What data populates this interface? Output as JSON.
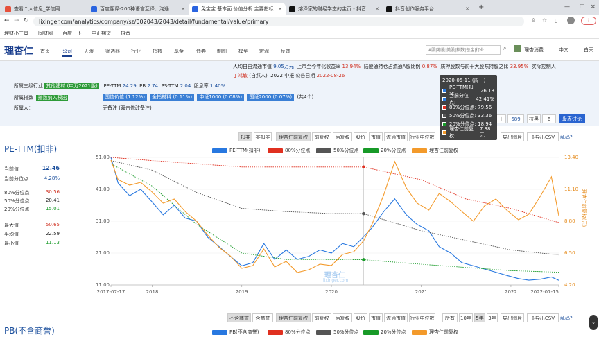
{
  "tabs": [
    {
      "title": "查看个人信息_学信网",
      "color": "#e6503b"
    },
    {
      "title": "百度翻译-200种语言互译、沟通",
      "color": "#2a64e0"
    },
    {
      "title": "免宝宝 基本面 价值分析 主要指标",
      "color": "#2a64e0"
    },
    {
      "title": "熔泽家的财经学堂的主页 - 抖音",
      "color": "#111111"
    },
    {
      "title": "抖音创作服务平台",
      "color": "#111111"
    }
  ],
  "address": {
    "url": "lixinger.com/analytics/company/sz/002043/2043/detail/fundamental/value/primary"
  },
  "bookmarks": [
    "理财小工具",
    "同财网",
    "百度一下",
    "中正期货",
    "抖音"
  ],
  "site": {
    "logo": "理杏仁",
    "nav": [
      "首页",
      "公司",
      "天眼",
      "筛选器",
      "行业",
      "指数",
      "基金",
      "债券",
      "制图",
      "模型",
      "宏观",
      "反馈"
    ],
    "search_placeholder": "A股|港股|美股|指数|基金|行业",
    "user": "理杏消费",
    "lang": "中文",
    "theme": "白天"
  },
  "info": {
    "row1_a": "人均自由流通市值",
    "row1_a_val": "9.05万元",
    "row1_b": "上市至今年化收益率",
    "row1_b_val": "13.94%",
    "row1_c": "陆股通持仓占流通A股比例",
    "row1_c_val": "0.87%",
    "row1_d": "质押股数与前十大股东持股之比",
    "row1_d_val": "33.95%",
    "row1_e": "实际控制人",
    "row2_a": "丁鸿敏",
    "row2_b": "(自然人)",
    "row2_c": "2022 中报 公告日期",
    "row2_d": "2022-08-26",
    "industry_label": "所属三级行业",
    "industry_tag": "其他建材 (申万2021版)",
    "pe_label": "PE-TTM",
    "pe_val": "24.29",
    "pb_label": "PB",
    "pb_val": "2.74",
    "ps_label": "PS-TTM",
    "ps_val": "2.04",
    "div_label": "股息率",
    "div_val": "1.40%",
    "index_label": "所属指数",
    "index_tag": "指数纳入预出",
    "indices": [
      "国信价值 (1.12%)",
      "全指材料 (0.11%)",
      "中证1000 (0.08%)",
      "国证2000 (0.07%)"
    ],
    "indices_count": "(共4个)",
    "remark_label": "所属人：",
    "remark_val": "无备注 (双击修改备注)"
  },
  "controls": {
    "right_count": "689",
    "right_btn": "拉黑",
    "right_num": "6",
    "discuss": "发表讨论"
  },
  "toolbar1": {
    "deduct": [
      "扣非",
      "非扣非"
    ],
    "adjust": [
      "理杏仁前复权",
      "前复权",
      "后复权",
      "股价",
      "市值",
      "流通市值",
      "行业中位数"
    ],
    "export_img": "导出图片",
    "export_csv": "导出CSV",
    "garbled": "乱码?"
  },
  "toolbar2": {
    "goodwill": [
      "不含商誉",
      "含商誉"
    ],
    "adjust": [
      "理杏仁前复权",
      "前复权",
      "后复权",
      "股价",
      "市值",
      "流通市值",
      "行业中位数"
    ],
    "periods": [
      "所有",
      "10年",
      "5年",
      "3年"
    ],
    "export_img": "导出图片",
    "export_csv": "导出CSV",
    "garbled": "乱码?"
  },
  "stats": {
    "title": "PE-TTM(扣非)",
    "current_label": "当前值",
    "current_val": "12.46",
    "pct_label": "当前分位点",
    "pct_val": "4.28%",
    "p80_label": "80%分位点",
    "p80_val": "30.56",
    "p50_label": "50%分位点",
    "p50_val": "20.41",
    "p20_label": "20%分位点",
    "p20_val": "15.01",
    "max_label": "最大值",
    "max_val": "50.65",
    "avg_label": "平均值",
    "avg_val": "22.59",
    "min_label": "最小值",
    "min_val": "11.13"
  },
  "tooltip": {
    "date": "2020-05-11 (周一)",
    "rows": [
      {
        "label": "PE-TTM(扣非):",
        "value": "26.13",
        "color": "#2878e0"
      },
      {
        "label": "当前分位点:",
        "value": "42.41%",
        "color": "#2878e0"
      },
      {
        "label": "80%分位点:",
        "value": "79.56",
        "color": "#e03020"
      },
      {
        "label": "50%分位点:",
        "value": "33.36",
        "color": "#555555"
      },
      {
        "label": "20%分位点:",
        "value": "18.94",
        "color": "#189a28"
      },
      {
        "label": "理杏仁前复权:",
        "value": "7.38元",
        "color": "#f39a2b"
      }
    ]
  },
  "legend1": [
    "PE-TTM(扣非)",
    "80%分位点",
    "50%分位点",
    "20%分位点",
    "理杏仁前复权"
  ],
  "legend2": [
    "PB(不含商誉)",
    "80%分位点",
    "50%分位点",
    "20%分位点",
    "理杏仁前复权"
  ],
  "section2_title": "PB(不含商誉)",
  "watermark": {
    "name": "理杏仁",
    "site": "lixinger.com"
  },
  "chart_data": {
    "type": "line",
    "x_ticks": [
      "2017-07-17",
      "2018",
      "2019",
      "2020",
      "2021",
      "2022",
      "2022-07-15"
    ],
    "y_left_ticks": [
      "51.00",
      "41.00",
      "31.00",
      "21.00",
      "11.00"
    ],
    "y_left_range": [
      11,
      51
    ],
    "y_right_ticks": [
      "13.40",
      "11.10",
      "8.80",
      "6.50",
      "4.20"
    ],
    "y_right_range": [
      4.2,
      13.4
    ],
    "y_right_label": "理杏仁前复权(元)",
    "x_range": [
      "2017-07-17",
      "2022-07-15"
    ],
    "series": [
      {
        "name": "PE-TTM(扣非)",
        "axis": "left",
        "color": "#2878e0",
        "x": [
          "2017-07-17",
          "2017-08-15",
          "2017-10-01",
          "2017-11-15",
          "2018-01-01",
          "2018-02-15",
          "2018-04-01",
          "2018-05-15",
          "2018-07-01",
          "2018-08-15",
          "2018-10-01",
          "2018-11-15",
          "2019-01-01",
          "2019-02-15",
          "2019-04-01",
          "2019-05-15",
          "2019-07-01",
          "2019-08-15",
          "2019-10-01",
          "2019-11-15",
          "2020-01-01",
          "2020-02-15",
          "2020-04-01",
          "2020-05-11",
          "2020-06-15",
          "2020-08-01",
          "2020-09-15",
          "2020-11-01",
          "2020-12-15",
          "2021-02-01",
          "2021-03-15",
          "2021-05-01",
          "2021-06-15",
          "2021-08-01",
          "2021-09-15",
          "2021-11-01",
          "2021-12-15",
          "2022-02-01",
          "2022-03-15",
          "2022-05-01",
          "2022-06-15",
          "2022-07-15"
        ],
        "y": [
          51,
          43,
          39,
          41,
          37,
          33,
          36,
          32,
          31,
          26,
          23,
          20,
          17,
          18,
          24,
          19,
          22,
          19,
          20,
          22,
          21,
          24,
          23,
          26.13,
          29,
          34,
          38,
          33,
          30,
          28,
          23,
          21,
          18,
          17,
          16,
          15,
          14,
          13,
          12.5,
          12.8,
          13.5,
          12.46
        ]
      },
      {
        "name": "80%分位点",
        "axis": "left",
        "color": "#e03020",
        "x": [
          "2017-07-17",
          "2018-01-01",
          "2018-07-01",
          "2019-01-01",
          "2019-07-01",
          "2020-01-01",
          "2020-05-11",
          "2021-01-01",
          "2021-07-01",
          "2022-01-01",
          "2022-07-15"
        ],
        "y": [
          51,
          50,
          49,
          48,
          48,
          48,
          48,
          44,
          38,
          35,
          30.56
        ]
      },
      {
        "name": "50%分位点",
        "axis": "left",
        "color": "#555555",
        "x": [
          "2017-07-17",
          "2018-01-01",
          "2018-07-01",
          "2019-01-01",
          "2019-07-01",
          "2020-01-01",
          "2020-05-11",
          "2021-01-01",
          "2021-07-01",
          "2022-01-01",
          "2022-07-15"
        ],
        "y": [
          50,
          47,
          40,
          35,
          34,
          33.4,
          33.36,
          28,
          25,
          22,
          20.41
        ]
      },
      {
        "name": "20%分位点",
        "axis": "left",
        "color": "#189a28",
        "x": [
          "2017-07-17",
          "2018-01-01",
          "2018-07-01",
          "2019-01-01",
          "2019-07-01",
          "2020-01-01",
          "2020-05-11",
          "2021-01-01",
          "2021-07-01",
          "2022-01-01",
          "2022-07-15"
        ],
        "y": [
          49,
          42,
          30,
          21,
          19,
          19,
          18.94,
          17.5,
          16.5,
          15.5,
          15.01
        ]
      },
      {
        "name": "理杏仁前复权",
        "axis": "right",
        "color": "#f39a2b",
        "x": [
          "2017-07-17",
          "2017-08-15",
          "2017-10-01",
          "2017-11-15",
          "2018-01-01",
          "2018-02-15",
          "2018-04-01",
          "2018-05-15",
          "2018-07-01",
          "2018-08-15",
          "2018-10-01",
          "2018-11-15",
          "2019-01-01",
          "2019-02-15",
          "2019-04-01",
          "2019-05-15",
          "2019-07-01",
          "2019-08-15",
          "2019-10-01",
          "2019-11-15",
          "2020-01-01",
          "2020-02-15",
          "2020-04-01",
          "2020-05-11",
          "2020-06-15",
          "2020-08-01",
          "2020-09-15",
          "2020-11-01",
          "2020-12-15",
          "2021-02-01",
          "2021-03-15",
          "2021-05-01",
          "2021-06-15",
          "2021-08-01",
          "2021-09-15",
          "2021-11-01",
          "2021-12-15",
          "2022-02-01",
          "2022-03-15",
          "2022-05-01",
          "2022-06-15",
          "2022-07-15"
        ],
        "y": [
          13.2,
          11.8,
          11.4,
          11.6,
          10.9,
          10.1,
          10.4,
          9.5,
          8.8,
          7.8,
          6.9,
          6.3,
          5.4,
          5.6,
          6.8,
          5.5,
          5.9,
          5.1,
          5.3,
          5.7,
          5.6,
          6.4,
          6.6,
          7.38,
          8.6,
          10.7,
          13.1,
          11.2,
          10.1,
          9.6,
          10.8,
          10.2,
          9.5,
          8.8,
          9.9,
          10.4,
          9.6,
          8.9,
          9.3,
          10.6,
          12.0,
          9.2
        ]
      }
    ],
    "tooltip_date": "2020-05-11",
    "markers": [
      {
        "series": "80%分位点",
        "x": "2020-05-11",
        "y": 48
      },
      {
        "series": "50%分位点",
        "x": "2020-05-11",
        "y": 33.36
      },
      {
        "series": "20%分位点",
        "x": "2020-05-11",
        "y": 18.94
      }
    ]
  }
}
